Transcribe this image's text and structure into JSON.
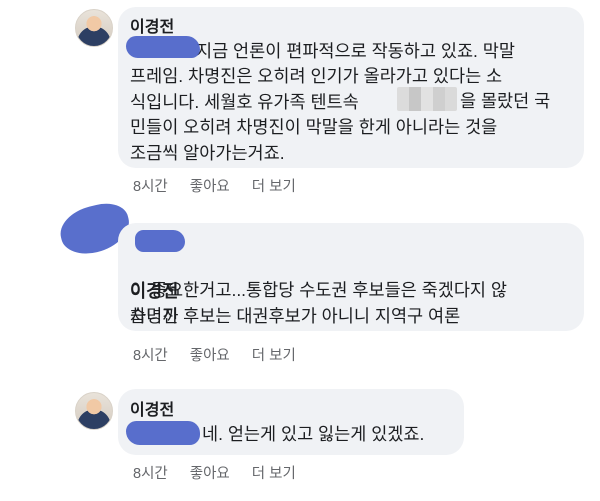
{
  "comments": [
    {
      "author": "이경전",
      "text_line1": "지금 언론이 편파적으로 작동하고 있죠. 막말",
      "text_rest": "프레임. 차명진은 오히려 인기가 올라가고 있다는 소\n식입니다. 세월호 유가족 텐트속",
      "text_tail": "을 몰랐던 국",
      "text_end": "민들이 오히려 차명진이 막말을 한게 아니라는 것을\n조금씩 알아가는거죠.",
      "time": "8시간",
      "like": "좋아요",
      "reply": "더 보기"
    },
    {
      "author": "이경전",
      "text_first": "차명진 후보는 대권후보가 아니니 지역구 여론",
      "text_rest": "이 중요한거고...통합당 수도권 후보들은 죽겠다지 않\n습니까",
      "time": "8시간",
      "like": "좋아요",
      "reply": "더 보기"
    },
    {
      "author": "이경전",
      "text": "네. 얻는게 있고 잃는게 있겠죠.",
      "time": "8시간",
      "like": "좋아요",
      "reply": "더 보기"
    }
  ],
  "colors": {
    "bubble": "#f0f2f5",
    "redaction": "#4b63c8",
    "meta": "#65676b"
  }
}
